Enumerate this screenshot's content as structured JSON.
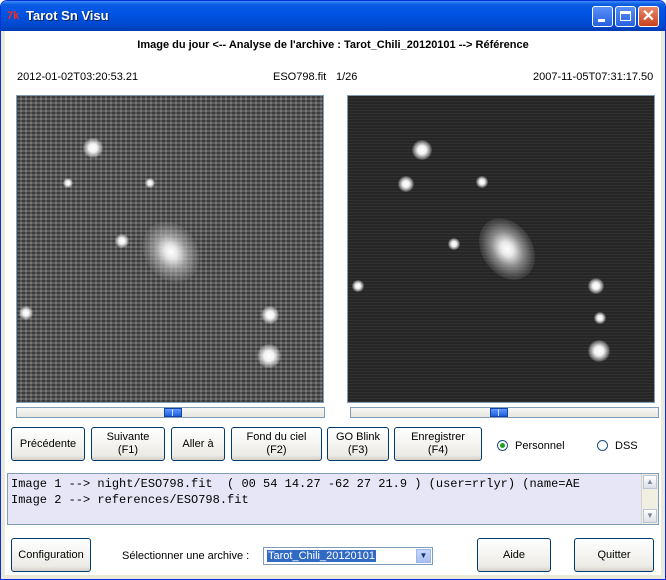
{
  "window": {
    "title": "Tarot Sn Visu",
    "app_icon_text": "7k",
    "close_glyph": "✕"
  },
  "header": {
    "text": "Image du jour <--  Analyse de l'archive : Tarot_Chili_20120101  --> Référence"
  },
  "info": {
    "left_date": "2012-01-02T03:20:53.21",
    "object_name": "ESO798.fit",
    "counter": "1/26",
    "right_date": "2007-11-05T07:31:17.50"
  },
  "images": {
    "left_slider_level": 0.51,
    "right_slider_level": 0.48
  },
  "buttons": {
    "previous": "Précédente",
    "next": "Suivante\n(F1)",
    "goto": "Aller à",
    "sky_bg": "Fond du ciel\n(F2)",
    "blink": "GO Blink\n(F3)",
    "save": "Enregistrer\n(F4)"
  },
  "radios": {
    "personal": {
      "label": "Personnel",
      "checked": true
    },
    "dss": {
      "label": "DSS",
      "checked": false
    }
  },
  "console": {
    "lines": [
      "Image 1 --> night/ESO798.fit  ( 00 54 14.27 -62 27 21.9 ) (user=rrlyr) (name=AE",
      "Image 2 --> references/ESO798.fit"
    ]
  },
  "bottom": {
    "config_button": "Configuration",
    "select_label": "Sélectionner une archive :",
    "select_value": "Tarot_Chili_20120101",
    "help_button": "Aide",
    "quit_button": "Quitter"
  },
  "colors": {
    "titlebar": "#0054e3",
    "window_frame": "#0831d9",
    "console_bg": "#e6e6f7",
    "selection": "#316ac5"
  }
}
